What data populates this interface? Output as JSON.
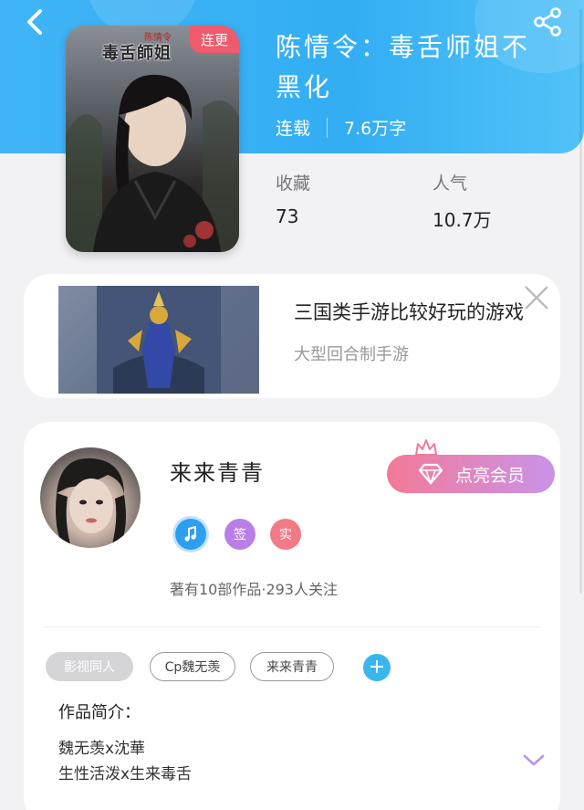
{
  "colors": {
    "header": "#40b4f6",
    "accent_blue": "#39b6ee",
    "badge_red": "#ef5a6c",
    "vip_start": "#f47a98",
    "vip_end": "#c993e8"
  },
  "header": {
    "back_icon": "chevron-left-icon",
    "share_icon": "share-icon"
  },
  "book": {
    "cover_title": "毒舌師姐",
    "cover_subtitle": "陈情令",
    "cover_badge": "连更",
    "title": "陈情令：毒舌师姐不黑化",
    "status": "连载",
    "word_count": "7.6万字",
    "stats": [
      {
        "label": "收藏",
        "value": "73"
      },
      {
        "label": "人气",
        "value": "10.7万"
      }
    ]
  },
  "ad": {
    "title": "三国类手游比较好玩的游戏",
    "subtitle": "大型回合制手游",
    "close_icon": "close-icon"
  },
  "author": {
    "name": "来来青青",
    "vip_button": "点亮会员",
    "badges": [
      {
        "icon": "music-medal-icon",
        "text": "",
        "color": "#2d9ff0"
      },
      {
        "icon": "sign-badge-icon",
        "text": "签",
        "color": "#b880e6"
      },
      {
        "icon": "verified-badge-icon",
        "text": "实",
        "color": "#f27a86"
      }
    ],
    "works_stats": "著有10部作品·293人关注"
  },
  "tags": [
    "影视同人",
    "Cp魏无羡",
    "来来青青"
  ],
  "intro": {
    "label": "作品简介：",
    "lines": [
      "魏无羡x沈華",
      "生性活泼x生来毒舌"
    ],
    "expand_icon": "chevron-down-icon"
  }
}
